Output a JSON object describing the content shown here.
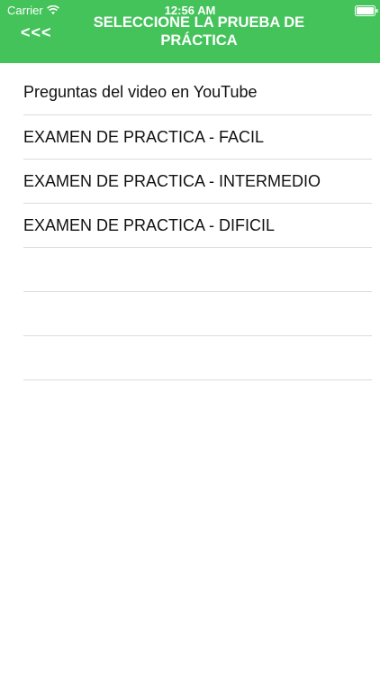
{
  "status_bar": {
    "carrier": "Carrier",
    "time": "12:56 AM"
  },
  "nav": {
    "back_label": "<<<",
    "title_line1": "SELECCIONE LA PRUEBA DE",
    "title_line2": "PRÁCTICA"
  },
  "list": {
    "items": [
      "Preguntas del video en YouTube",
      "EXAMEN DE PRACTICA - FACIL",
      "EXAMEN DE PRACTICA - INTERMEDIO",
      "EXAMEN DE PRACTICA - DIFICIL",
      "",
      "",
      ""
    ]
  },
  "colors": {
    "header_bg": "#43c35a",
    "separator": "#dcdcdc"
  }
}
